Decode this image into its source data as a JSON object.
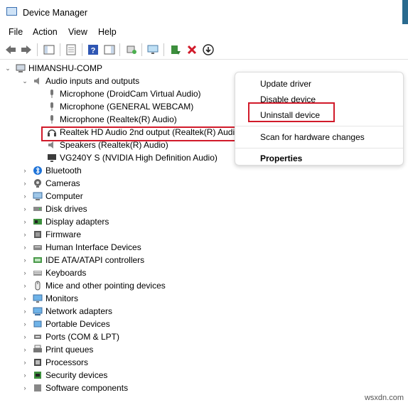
{
  "window": {
    "title": "Device Manager"
  },
  "menu": [
    "File",
    "Action",
    "View",
    "Help"
  ],
  "tree": {
    "root": "HIMANSHU-COMP",
    "audio_group": "Audio inputs and outputs",
    "audio_children": [
      "Microphone (DroidCam Virtual Audio)",
      "Microphone (GENERAL WEBCAM)",
      "Microphone (Realtek(R) Audio)",
      "Realtek HD Audio 2nd output (Realtek(R) Audio)",
      "Speakers (Realtek(R) Audio)",
      "VG240Y S (NVIDIA High Definition Audio)"
    ],
    "categories": [
      "Bluetooth",
      "Cameras",
      "Computer",
      "Disk drives",
      "Display adapters",
      "Firmware",
      "Human Interface Devices",
      "IDE ATA/ATAPI controllers",
      "Keyboards",
      "Mice and other pointing devices",
      "Monitors",
      "Network adapters",
      "Portable Devices",
      "Ports (COM & LPT)",
      "Print queues",
      "Processors",
      "Security devices",
      "Software components"
    ]
  },
  "context_menu": {
    "update": "Update driver",
    "disable": "Disable device",
    "uninstall": "Uninstall device",
    "scan": "Scan for hardware changes",
    "properties": "Properties"
  },
  "watermark": "wsxdn.com",
  "colors": {
    "highlight_box": "#d11a2a",
    "uninstall_x": "#d11a2a"
  }
}
